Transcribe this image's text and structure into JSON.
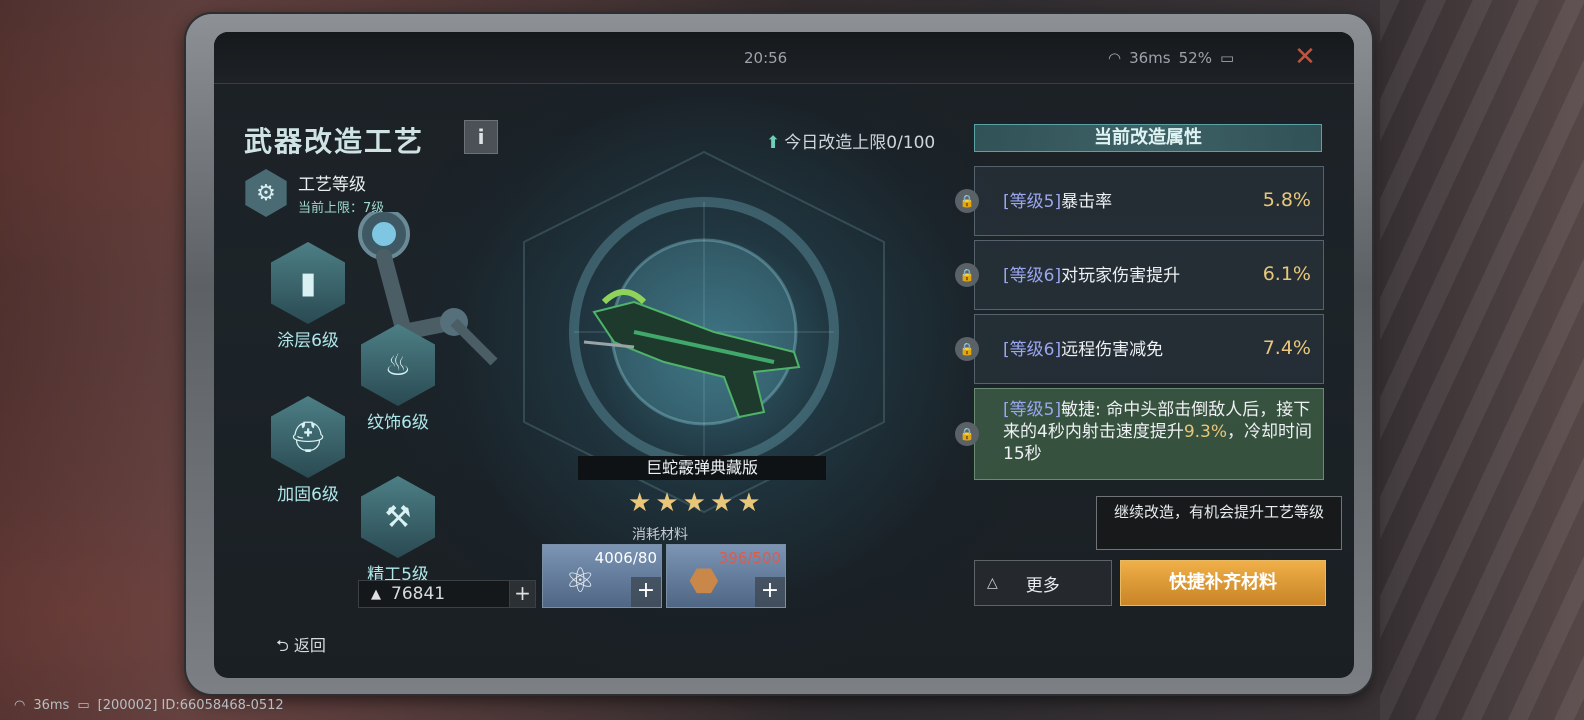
{
  "window": {
    "time": "20:56",
    "ping": "36ms",
    "battery": "52%"
  },
  "header": {
    "title": "武器改造工艺",
    "info_label": "i",
    "daily_limit": "今日改造上限0/100"
  },
  "craft": {
    "label": "工艺等级",
    "limit": "当前上限：7级"
  },
  "nodes": [
    {
      "label": "涂层6级",
      "icon": "spray-icon"
    },
    {
      "label": "纹饰6级",
      "icon": "flame-icon"
    },
    {
      "label": "加固6级",
      "icon": "helmet-icon"
    },
    {
      "label": "精工5级",
      "icon": "drill-icon"
    }
  ],
  "gold": {
    "value": "76841",
    "plus": "+"
  },
  "back_label": "返回",
  "weapon": {
    "name": "巨蛇霰弹典藏版",
    "stars": 5
  },
  "materials": {
    "label": "消耗材料",
    "items": [
      {
        "count": "4006/80",
        "icon": "molecule-icon",
        "insufficient": false
      },
      {
        "count": "396/500",
        "icon": "ore-icon",
        "insufficient": true
      }
    ],
    "plus": "+"
  },
  "attributes": {
    "header": "当前改造属性",
    "items": [
      {
        "level": "[等级5]",
        "name": "暴击率",
        "value": "5.8%"
      },
      {
        "level": "[等级6]",
        "name": "对玩家伤害提升",
        "value": "6.1%"
      },
      {
        "level": "[等级6]",
        "name": "远程伤害减免",
        "value": "7.4%"
      }
    ],
    "special": {
      "level": "[等级5]",
      "text_a": "敏捷: 命中头部击倒敌人后，接下来的4秒内射击速度提升",
      "highlight": "9.3%",
      "text_b": "，冷却时间15秒"
    }
  },
  "tooltip": "继续改造，有机会提升工艺等级",
  "buttons": {
    "more": "更多",
    "quick": "快捷补齐材料"
  },
  "footer": {
    "ping": "36ms",
    "id": "[200002] ID:66058468-0512"
  },
  "colors": {
    "accent": "#e8c77a",
    "teal": "#aee7ea",
    "level": "#9aa6ef",
    "quick_button": "#e0a03c"
  }
}
